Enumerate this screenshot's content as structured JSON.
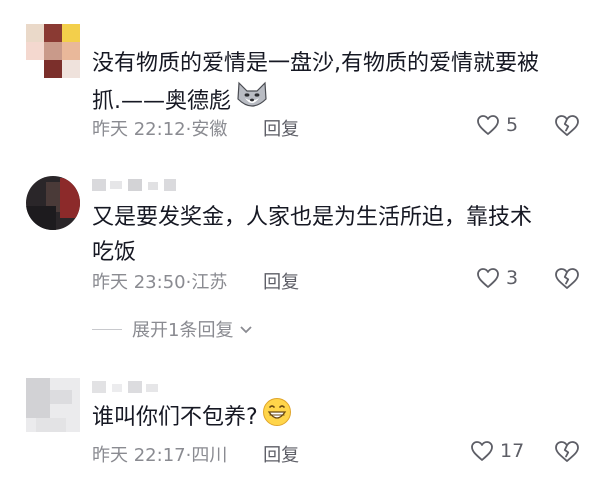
{
  "comments": [
    {
      "text_line1": "没有物质的爱情是一盘沙,有物质的爱情就要被",
      "text_line2": "抓.——奥德彪",
      "emoji": "wolf-face-emoji",
      "time": "昨天 22:12",
      "location": "安徽",
      "reply_label": "回复",
      "likes": "5"
    },
    {
      "text_line1": "又是要发奖金，人家也是为生活所迫，靠技术",
      "text_line2": "吃饭",
      "time": "昨天 23:50",
      "location": "江苏",
      "reply_label": "回复",
      "likes": "3"
    },
    {
      "text_line1": "谁叫你们不包养?",
      "emoji": "grinning-face-emoji",
      "time": "昨天 22:17",
      "location": "四川",
      "reply_label": "回复",
      "likes": "17"
    }
  ],
  "expand_replies": {
    "label": "展开1条回复"
  },
  "colors": {
    "text": "#161823",
    "meta": "#8a8b91",
    "action": "#5d5e66"
  }
}
